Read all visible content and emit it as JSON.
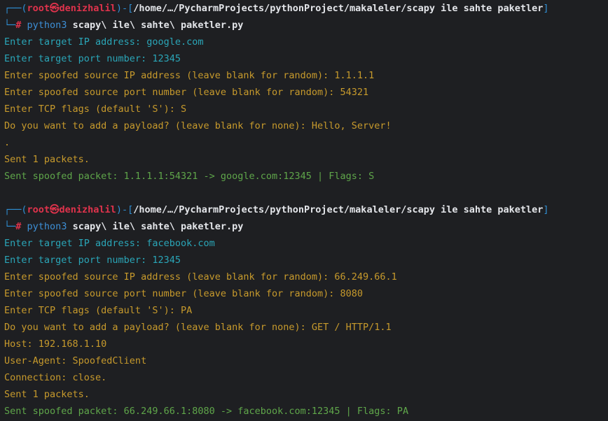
{
  "colors": {
    "background": "#1e1f22",
    "prompt_frame": "#2f8fd5",
    "user": "#e0334c",
    "input_prompt": "#2aa6b8",
    "question": "#c79a2c",
    "success": "#5fa64a"
  },
  "sessions": [
    {
      "prompt": {
        "frame_top": "┌──(",
        "user": "root㉿denizhalil",
        "frame_mid": ")-[",
        "path": "/home/…/PycharmProjects/pythonProject/makaleler/scapy ile sahte paketler",
        "frame_end": "]",
        "frame_bottom": "└─",
        "hash": "#",
        "command_exec": "python3",
        "command_args": " scapy\\ ile\\ sahte\\ paketler.py"
      },
      "inputs": [
        "Enter target IP address: google.com",
        "Enter target port number: 12345"
      ],
      "questions": [
        "Enter spoofed source IP address (leave blank for random): 1.1.1.1",
        "Enter spoofed source port number (leave blank for random): 54321",
        "Enter TCP flags (default 'S'): S",
        "Do you want to add a payload? (leave blank for none): Hello, Server!",
        ".",
        "Sent 1 packets."
      ],
      "result": "Sent spoofed packet: 1.1.1.1:54321 -> google.com:12345 | Flags: S"
    },
    {
      "prompt": {
        "frame_top": "┌──(",
        "user": "root㉿denizhalil",
        "frame_mid": ")-[",
        "path": "/home/…/PycharmProjects/pythonProject/makaleler/scapy ile sahte paketler",
        "frame_end": "]",
        "frame_bottom": "└─",
        "hash": "#",
        "command_exec": "python3",
        "command_args": " scapy\\ ile\\ sahte\\ paketler.py"
      },
      "inputs": [
        "Enter target IP address: facebook.com",
        "Enter target port number: 12345"
      ],
      "questions": [
        "Enter spoofed source IP address (leave blank for random): 66.249.66.1",
        "Enter spoofed source port number (leave blank for random): 8080",
        "Enter TCP flags (default 'S'): PA",
        "Do you want to add a payload? (leave blank for none): GET / HTTP/1.1",
        "Host: 192.168.1.10",
        "User-Agent: SpoofedClient",
        "Connection: close.",
        "Sent 1 packets."
      ],
      "result": "Sent spoofed packet: 66.249.66.1:8080 -> facebook.com:12345 | Flags: PA"
    }
  ]
}
